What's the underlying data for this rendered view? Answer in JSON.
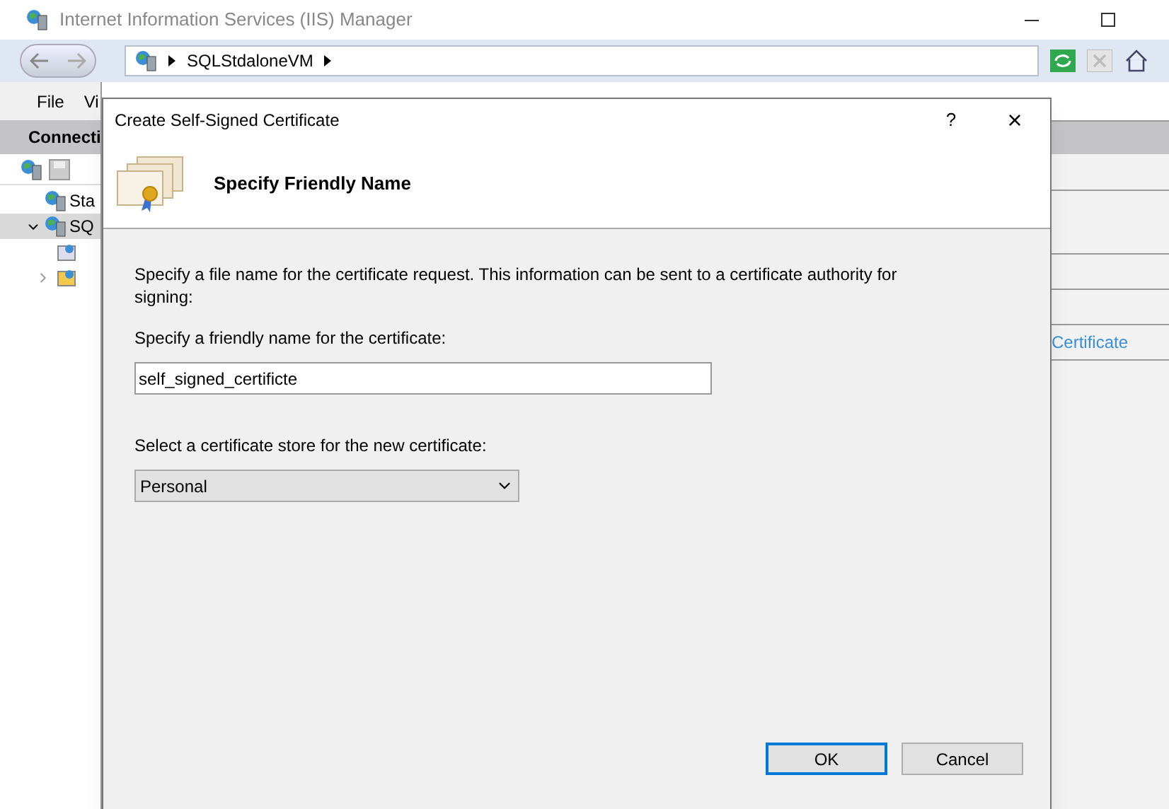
{
  "window": {
    "title": "Internet Information Services (IIS) Manager"
  },
  "address": {
    "segments": [
      "SQLStdaloneVM"
    ]
  },
  "menu": [
    "File",
    "Vi"
  ],
  "connections": {
    "title": "Connecti",
    "tree": [
      {
        "label": "Sta",
        "selected": false
      },
      {
        "label": "SQ",
        "expanded": true,
        "selected": true,
        "children": [
          {
            "kind": "pool"
          },
          {
            "kind": "folder"
          }
        ]
      }
    ]
  },
  "actions": {
    "link": "Certificate"
  },
  "dialog": {
    "title": "Create Self-Signed Certificate",
    "help": "?",
    "close": "×",
    "heading": "Specify Friendly Name",
    "intro": "Specify a file name for the certificate request.  This information can be sent to a certificate authority for signing:",
    "name_label": "Specify a friendly name for the certificate:",
    "name_value": "self_signed_certificte",
    "store_label": "Select a certificate store for the new certificate:",
    "store_value": "Personal",
    "buttons": [
      {
        "label": "OK",
        "selected": true
      },
      {
        "label": "Cancel",
        "selected": false
      }
    ]
  }
}
